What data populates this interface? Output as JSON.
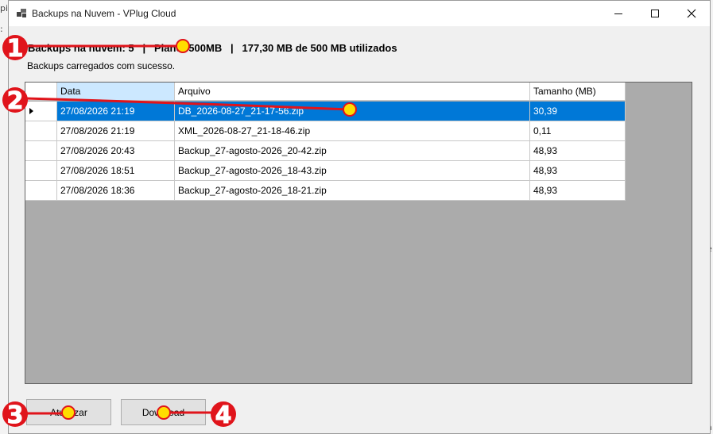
{
  "background": {
    "left_top_text": "pi",
    "left_mid_text": ":",
    "right_mid_text": "e",
    "right_bottom_text": "a"
  },
  "window": {
    "title": "Backups na Nuvem - VPlug Cloud",
    "icon": "app-windows-icon",
    "controls": [
      "minimize-icon",
      "maximize-icon",
      "close-icon"
    ]
  },
  "summary": "Backups na nuvem: 5   |   Plano: 500MB   |   177,30 MB de 500 MB utilizados",
  "status": "Backups carregados com sucesso.",
  "table": {
    "columns": [
      "Data",
      "Arquivo",
      "Tamanho (MB)"
    ],
    "sorted_column": "Data",
    "selected_row": 0,
    "rows": [
      {
        "data": "27/08/2026 21:19",
        "arquivo": "DB_2026-08-27_21-17-56.zip",
        "tamanho": "30,39"
      },
      {
        "data": "27/08/2026 21:19",
        "arquivo": "XML_2026-08-27_21-18-46.zip",
        "tamanho": "0,11"
      },
      {
        "data": "27/08/2026 20:43",
        "arquivo": "Backup_27-agosto-2026_20-42.zip",
        "tamanho": "48,93"
      },
      {
        "data": "27/08/2026 18:51",
        "arquivo": "Backup_27-agosto-2026_18-43.zip",
        "tamanho": "48,93"
      },
      {
        "data": "27/08/2026 18:36",
        "arquivo": "Backup_27-agosto-2026_18-21.zip",
        "tamanho": "48,93"
      }
    ]
  },
  "buttons": {
    "refresh": "Atualizar",
    "download": "Download"
  },
  "annotations": {
    "markers": [
      "1",
      "2",
      "3",
      "4"
    ],
    "colors": {
      "line": "#e0141b",
      "marker": "#e0141b",
      "dot": "#ffdd00"
    }
  }
}
